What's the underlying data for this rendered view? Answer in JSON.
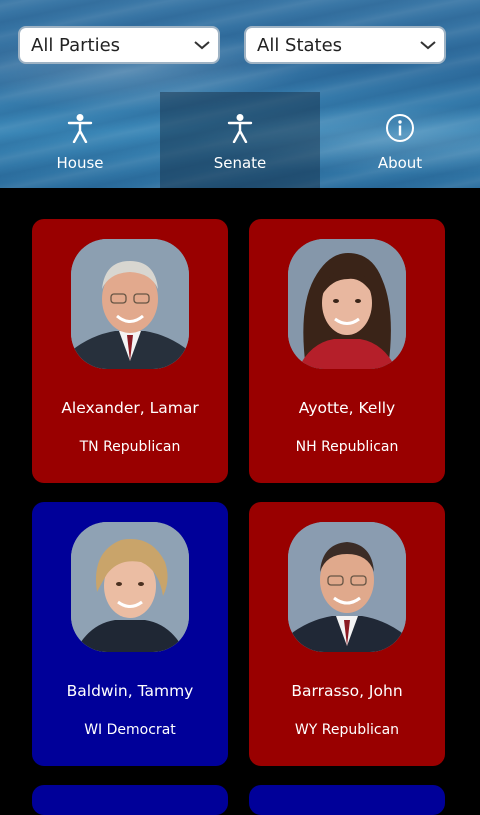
{
  "filters": {
    "party": "All Parties",
    "state": "All States"
  },
  "tabs": [
    {
      "label": "House",
      "icon": "person-icon",
      "active": false
    },
    {
      "label": "Senate",
      "icon": "person-icon",
      "active": true
    },
    {
      "label": "About",
      "icon": "info-icon",
      "active": false
    }
  ],
  "colors": {
    "republican": "#990000",
    "democrat": "#000099"
  },
  "members": [
    {
      "name": "Alexander, Lamar",
      "party": "TN Republican"
    },
    {
      "name": "Ayotte, Kelly",
      "party": "NH Republican"
    },
    {
      "name": "Baldwin, Tammy",
      "party": "WI Democrat"
    },
    {
      "name": "Barrasso, John",
      "party": "WY Republican"
    }
  ]
}
